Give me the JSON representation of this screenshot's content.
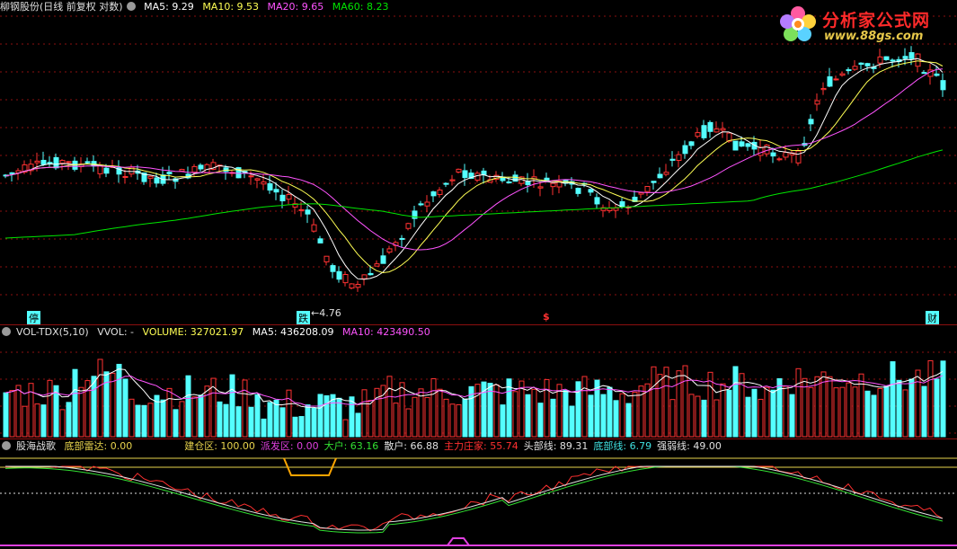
{
  "main": {
    "title": "柳钢股份(日线 前复权 对数)",
    "ma5_label": "MA5:",
    "ma5": "9.29",
    "ma10_label": "MA10:",
    "ma10": "9.53",
    "ma20_label": "MA20:",
    "ma20": "9.65",
    "ma60_label": "MA60:",
    "ma60": "8.23",
    "low_marker": "←4.76",
    "bottom_marks": [
      "停",
      "跌",
      "$",
      "财"
    ]
  },
  "volume": {
    "title": "VOL-TDX(5,10)",
    "vvol_label": "VVOL: -",
    "volume_label": "VOLUME:",
    "volume": "327021.97",
    "ma5_label": "MA5:",
    "ma5": "436208.09",
    "ma10_label": "MA10:",
    "ma10": "423490.50"
  },
  "indicator": {
    "title": "股海战歌",
    "items": [
      {
        "label": "底部雷达:",
        "value": "0.00",
        "color": "#e8d44d"
      },
      {
        "label": "建仓区:",
        "value": "100.00",
        "color": "#e8d44d"
      },
      {
        "label": "派发区:",
        "value": "0.00",
        "color": "#e040e0"
      },
      {
        "label": "大户:",
        "value": "63.16",
        "color": "#32e032"
      },
      {
        "label": "散户:",
        "value": "66.88",
        "color": "#e0e0e0"
      },
      {
        "label": "主力庄家:",
        "value": "55.74",
        "color": "#ff3030"
      },
      {
        "label": "头部线:",
        "value": "89.31",
        "color": "#e0e0e0"
      },
      {
        "label": "底部线:",
        "value": "6.79",
        "color": "#40e0e0"
      },
      {
        "label": "强弱线:",
        "value": "49.00",
        "color": "#e0e0e0"
      }
    ]
  },
  "logo": {
    "name": "分析家公式网",
    "url": "www.88gs.com"
  },
  "colors": {
    "up": "#ff3232",
    "down": "#54ffff",
    "ma5": "#ffffff",
    "ma10": "#ffff54",
    "ma20": "#ff54ff",
    "ma60": "#00e600",
    "grid": "#8c1010"
  }
}
